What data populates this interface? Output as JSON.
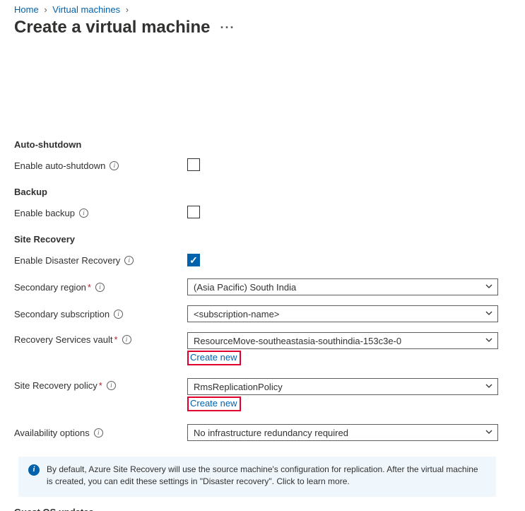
{
  "breadcrumb": {
    "home": "Home",
    "vms": "Virtual machines"
  },
  "page_title": "Create a virtual machine",
  "sections": {
    "auto_shutdown": {
      "heading": "Auto-shutdown",
      "enable_label": "Enable auto-shutdown",
      "enable_checked": false
    },
    "backup": {
      "heading": "Backup",
      "enable_label": "Enable backup",
      "enable_checked": false
    },
    "site_recovery": {
      "heading": "Site Recovery",
      "enable_label": "Enable Disaster Recovery",
      "enable_checked": true,
      "secondary_region_label": "Secondary region",
      "secondary_region_value": "(Asia Pacific) South India",
      "secondary_sub_label": "Secondary subscription",
      "secondary_sub_value": "<subscription-name>",
      "vault_label": "Recovery Services vault",
      "vault_value": "ResourceMove-southeastasia-southindia-153c3e-0",
      "vault_create_new": "Create new",
      "policy_label": "Site Recovery policy",
      "policy_value": "RmsReplicationPolicy",
      "policy_create_new": "Create new",
      "availability_label": "Availability options",
      "availability_value": "No infrastructure redundancy required"
    }
  },
  "info_banner": "By default, Azure Site Recovery will use the source machine's configuration for replication. After the virtual machine is created, you can edit these settings in \"Disaster recovery\". Click to learn more.",
  "guest_os_heading_partial": "Guest OS updates"
}
